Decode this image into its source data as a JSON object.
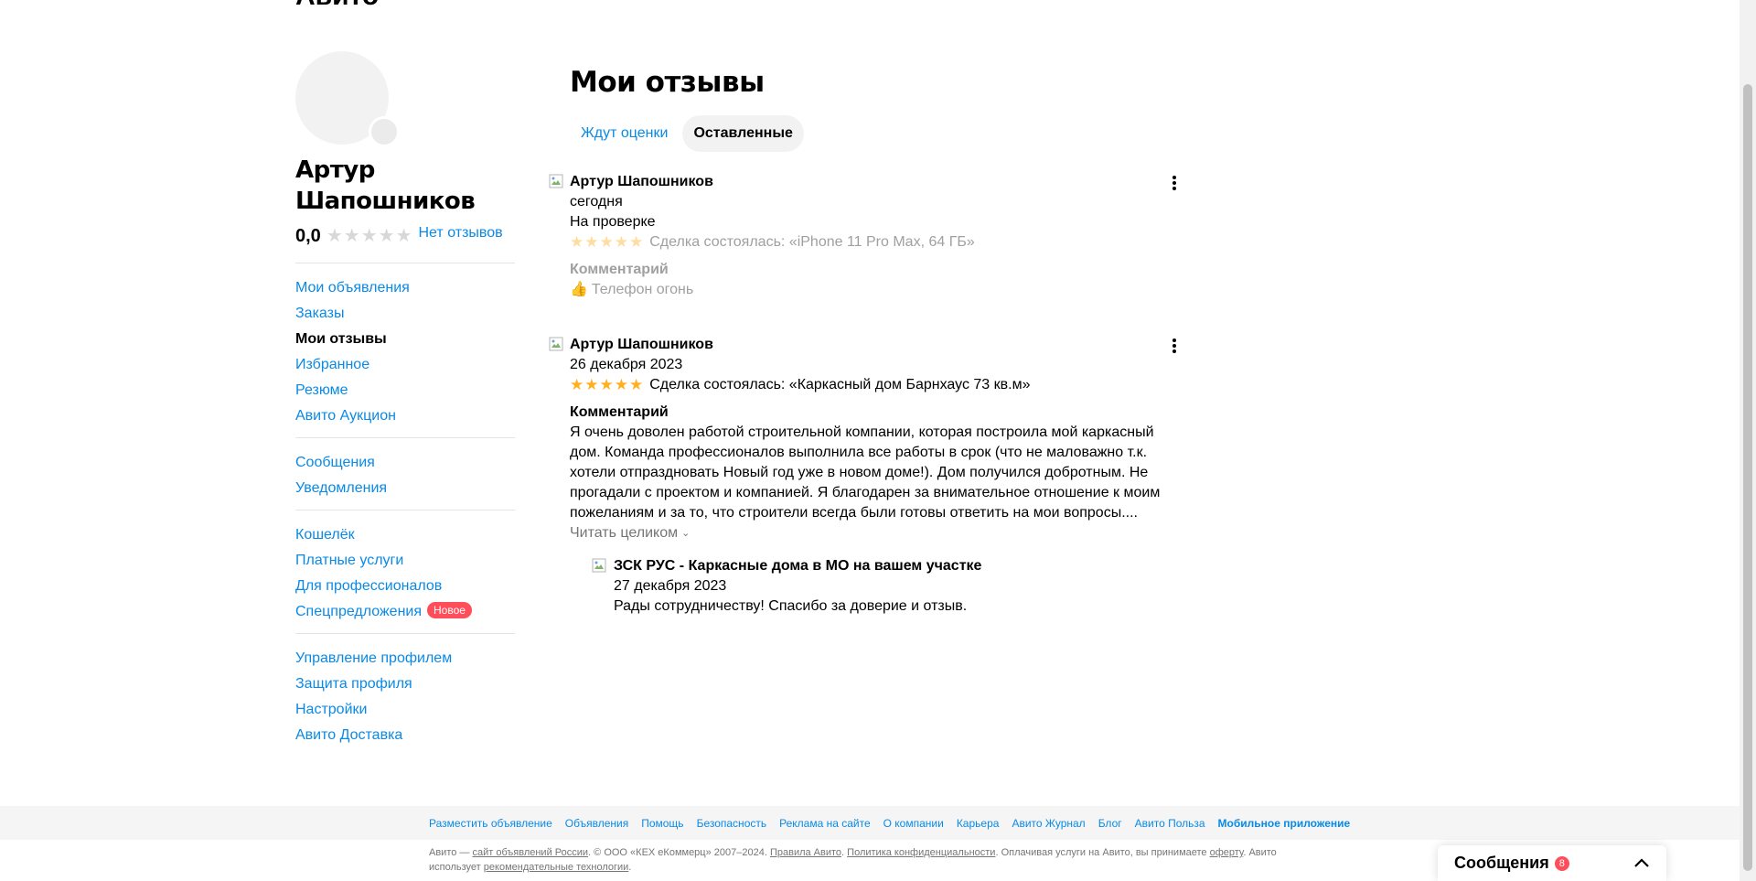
{
  "header": {
    "logo": "Авито",
    "breadcrumb": ""
  },
  "profile": {
    "name": "Артур Шапошников",
    "rating": "0,0",
    "no_reviews": "Нет отзывов"
  },
  "sidebar": {
    "group1": [
      {
        "label": "Мои объявления"
      },
      {
        "label": "Заказы"
      },
      {
        "label": "Мои отзывы",
        "active": true
      },
      {
        "label": "Избранное"
      },
      {
        "label": "Резюме"
      },
      {
        "label": "Авито Аукцион"
      }
    ],
    "group2": [
      {
        "label": "Сообщения"
      },
      {
        "label": "Уведомления"
      }
    ],
    "group3": [
      {
        "label": "Кошелёк"
      },
      {
        "label": "Платные услуги"
      },
      {
        "label": "Для профессионалов"
      },
      {
        "label": "Спецпредложения",
        "badge": "Новое"
      }
    ],
    "group4": [
      {
        "label": "Управление профилем"
      },
      {
        "label": "Защита профиля"
      },
      {
        "label": "Настройки"
      },
      {
        "label": "Авито Доставка"
      }
    ]
  },
  "main": {
    "title": "Мои отзывы",
    "tabs": [
      {
        "label": "Ждут оценки"
      },
      {
        "label": "Оставленные",
        "active": true
      }
    ]
  },
  "reviews": [
    {
      "author": "Артур Шапошников",
      "date": "сегодня",
      "status": "На проверке",
      "stars": 5,
      "deal": "Сделка состоялась: «iPhone 11 Pro Max, 64 ГБ»",
      "comment_label": "Комментарий",
      "comment_icon": "thumbs-up-icon",
      "comment": "Телефон огонь"
    },
    {
      "author": "Артур Шапошников",
      "date": "26 декабря 2023",
      "stars": 5,
      "deal": "Сделка состоялась: «Каркасный дом Барнхаус 73 кв.м»",
      "comment_label": "Комментарий",
      "comment_lines": [
        "Я очень доволен работой строительной компании, которая построила мой каркасный",
        "дом. Команда профессионалов выполнила все работы в срок (что не маловажно т.к.",
        "хотели отпраздновать Новый год уже в новом доме!). Дом получился добротным. Не",
        "прогадали с проектом и компанией. Я благодарен за внимательное отношение к моим",
        "пожеланиям и за то, что строители всегда были готовы ответить на мои вопросы...."
      ],
      "read_more": "Читать целиком",
      "reply": {
        "author": "ЗСК РУС - Каркасные дома в МО на вашем участке",
        "date": "27 декабря 2023",
        "text": "Рады сотрудничеству! Спасибо за доверие и отзыв."
      }
    }
  ],
  "footer": {
    "links": [
      {
        "label": "Разместить объявление"
      },
      {
        "label": "Объявления"
      },
      {
        "label": "Помощь"
      },
      {
        "label": "Безопасность"
      },
      {
        "label": "Реклама на сайте"
      },
      {
        "label": "О компании"
      },
      {
        "label": "Карьера"
      },
      {
        "label": "Авито Журнал"
      },
      {
        "label": "Блог"
      },
      {
        "label": "Авито Польза"
      },
      {
        "label": "Мобильное приложение",
        "bold": true
      }
    ],
    "copy": {
      "p1": "Авито — ",
      "l1": "сайт объявлений России",
      "p2": ". © ООО «КЕХ еКоммерц» 2007–2024. ",
      "l2": "Правила Авито",
      "p3": ". ",
      "l3": "Политика конфиденциальности",
      "p4": ". Оплачивая услуги на Авито, вы принимаете ",
      "l4": "оферту",
      "p5": ". Авито использует ",
      "l5": "рекомендательные технологии",
      "p6": "."
    }
  },
  "messages_widget": {
    "title": "Сообщения",
    "count": "8"
  },
  "colors": {
    "accent": "#0a8ae6",
    "star": "#ffb021",
    "badge": "#ff4d5a"
  }
}
